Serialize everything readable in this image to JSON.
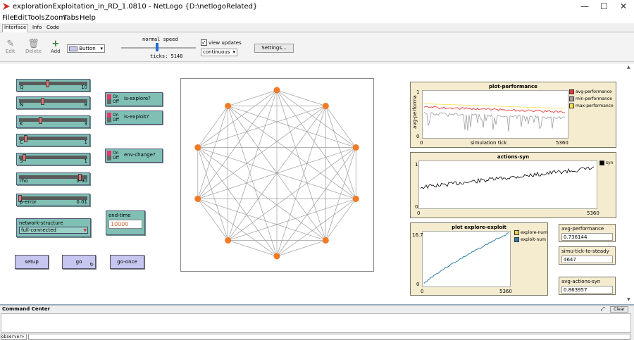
{
  "window": {
    "title": "explorationExploitation_in_RD_1.0810 - NetLogo {D:\\netlogoRelated}",
    "minimize": "—",
    "maximize": "☐",
    "close": "✕"
  },
  "menu": [
    "File",
    "Edit",
    "Tools",
    "Zoom",
    "Tabs",
    "Help"
  ],
  "tabs": [
    "Interface",
    "Info",
    "Code"
  ],
  "toolbar": {
    "edit": "Edit",
    "delete": "Delete",
    "add": "Add",
    "widget_type": "Button",
    "speed_label": "normal speed",
    "ticks_label": "ticks: 5148",
    "view_updates": "view updates",
    "update_mode": "continuous",
    "settings": "Settings..."
  },
  "sliders": [
    {
      "label": "Q",
      "value": "10",
      "fraction": 0.42
    },
    {
      "label": "N",
      "value": "8",
      "fraction": 0.35
    },
    {
      "label": "K",
      "value": "3",
      "fraction": 0.32
    },
    {
      "label": "C",
      "value": "1",
      "fraction": 0.1
    },
    {
      "label": "S",
      "value": "1",
      "fraction": 0.08
    },
    {
      "label": "rho",
      "value": "0.90",
      "fraction": 0.9
    },
    {
      "label": "p-error",
      "value": "0.01",
      "fraction": 0.02
    }
  ],
  "switches": [
    {
      "label": "is-explore?",
      "on": "On",
      "off": "Off"
    },
    {
      "label": "is-exploit?",
      "on": "On",
      "off": "Off"
    },
    {
      "label": "env-change?",
      "on": "On",
      "off": "Off"
    }
  ],
  "chooser": {
    "label": "network-structure",
    "value": "full-connected"
  },
  "input": {
    "label": "end-time",
    "value": "10000"
  },
  "buttons": {
    "setup": "setup",
    "go": "go",
    "go_once": "go-once"
  },
  "plots": {
    "performance": {
      "title": "plot-performance",
      "xlabel": "simulation tick",
      "ylabel": "avg-performa",
      "xmin": "0",
      "xmax": "5360",
      "ymax": "1",
      "ymin": "0",
      "legend": [
        {
          "name": "avg-performance",
          "color": "#e53935"
        },
        {
          "name": "min-performance",
          "color": "#9e9e9e"
        },
        {
          "name": "max-performance",
          "color": "#f4e04d"
        }
      ]
    },
    "actions": {
      "title": "actions-syn",
      "xmin": "0",
      "xmax": "5360",
      "ymax": "1",
      "ymin": "0",
      "legend": [
        {
          "name": "syn",
          "color": "#000000"
        }
      ]
    },
    "explore": {
      "title": "plot explore-exploit",
      "xmin": "0",
      "xmax": "5360",
      "ymax": "16.7",
      "ymin": "0",
      "legend": [
        {
          "name": "explore-num",
          "color": "#e8d44d"
        },
        {
          "name": "exploit-num",
          "color": "#2e7fa6"
        }
      ]
    }
  },
  "monitors": [
    {
      "label": "avg-performance",
      "value": "0.736144"
    },
    {
      "label": "simu-tick-to-steady",
      "value": "4647"
    },
    {
      "label": "avg-actions-syn",
      "value": "0.863957"
    }
  ],
  "network": {
    "nodes": 10,
    "node_color": "#f07b24",
    "link_color": "#9e9e9e"
  },
  "command_center": {
    "title": "Command Center",
    "clear": "Clear",
    "prompt": "observer>"
  }
}
